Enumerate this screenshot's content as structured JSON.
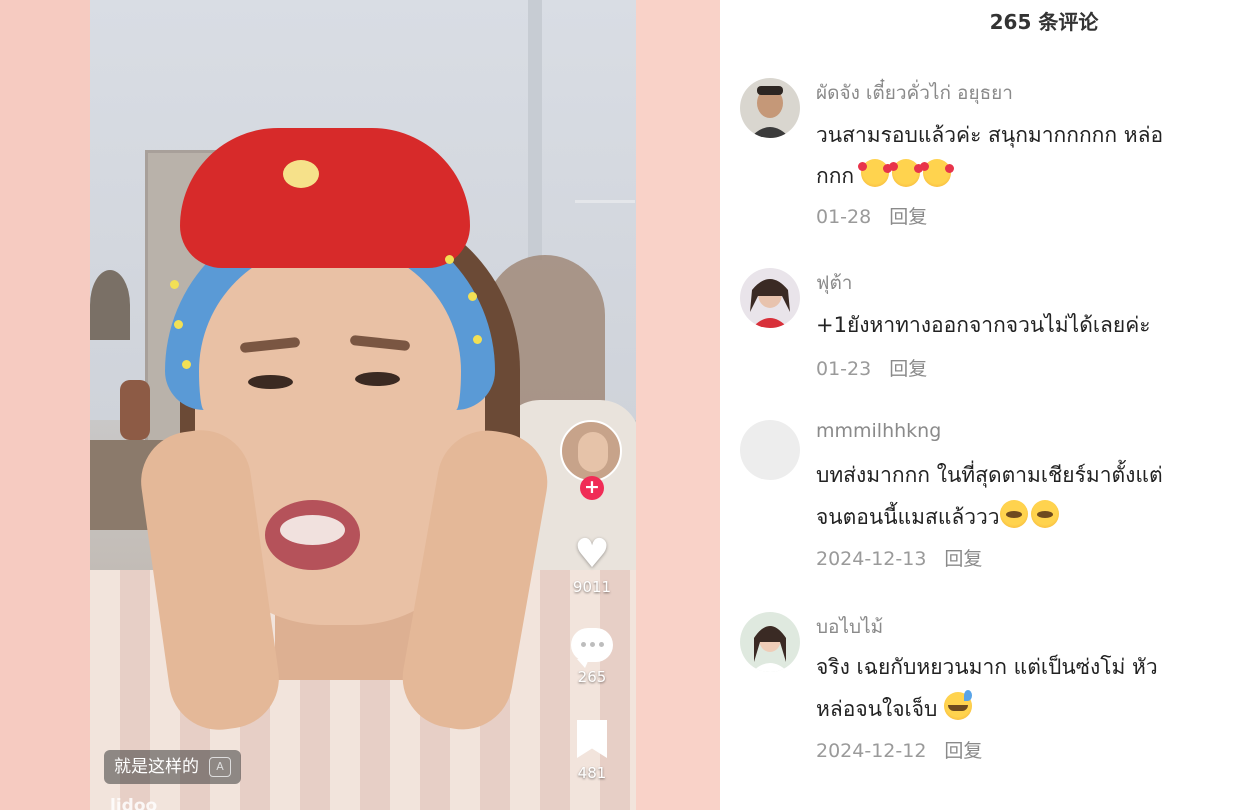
{
  "video": {
    "caption_chip": "就是这样的",
    "caption_chip_icon": "translate-a-icon",
    "creator_name": "lidoo",
    "like_count": "9011",
    "comment_count": "265",
    "bookmark_count": "481",
    "follow_symbol": "+"
  },
  "comments_panel": {
    "title": "265 条评论",
    "comments": [
      {
        "name": "ผัดจัง เตี๋ยวคั่วไก่ อยุธยา",
        "text_lines": [
          "วนสามรอบแล้วค่ะ สนุกมากกกกก หล่อ",
          "กกก"
        ],
        "emojis": [
          "smiling-face-with-hearts",
          "smiling-face-with-hearts",
          "smiling-face-with-hearts"
        ],
        "date": "01-28",
        "reply_label": "回复"
      },
      {
        "name": "ฟุต้า",
        "text_lines": [
          "+1ยังหาทางออกจากจวนไม่ได้เลยค่ะ"
        ],
        "emojis": [],
        "date": "01-23",
        "reply_label": "回复"
      },
      {
        "name": "mmmilhhkng",
        "text_lines": [
          "บทส่งมากกก ในที่สุดตามเชียร์มาตั้งแต่",
          "จนตอนนี้แมสแล้ววว"
        ],
        "emojis": [
          "pleading-face",
          "pleading-face"
        ],
        "date": "2024-12-13",
        "reply_label": "回复"
      },
      {
        "name": "บอไบไม้",
        "text_lines": [
          "จริง เฉยกับหยวนมาก แต่เป็นซ่งโม่ หัว",
          "หล่อจนใจเจ็บ"
        ],
        "emojis": [
          "grinning-face-with-sweat"
        ],
        "date": "2024-12-12",
        "reply_label": "回复"
      }
    ]
  },
  "colors": {
    "background_pink": "#f7d3ca",
    "follow_red": "#f02c56",
    "panel_white": "#ffffff"
  }
}
